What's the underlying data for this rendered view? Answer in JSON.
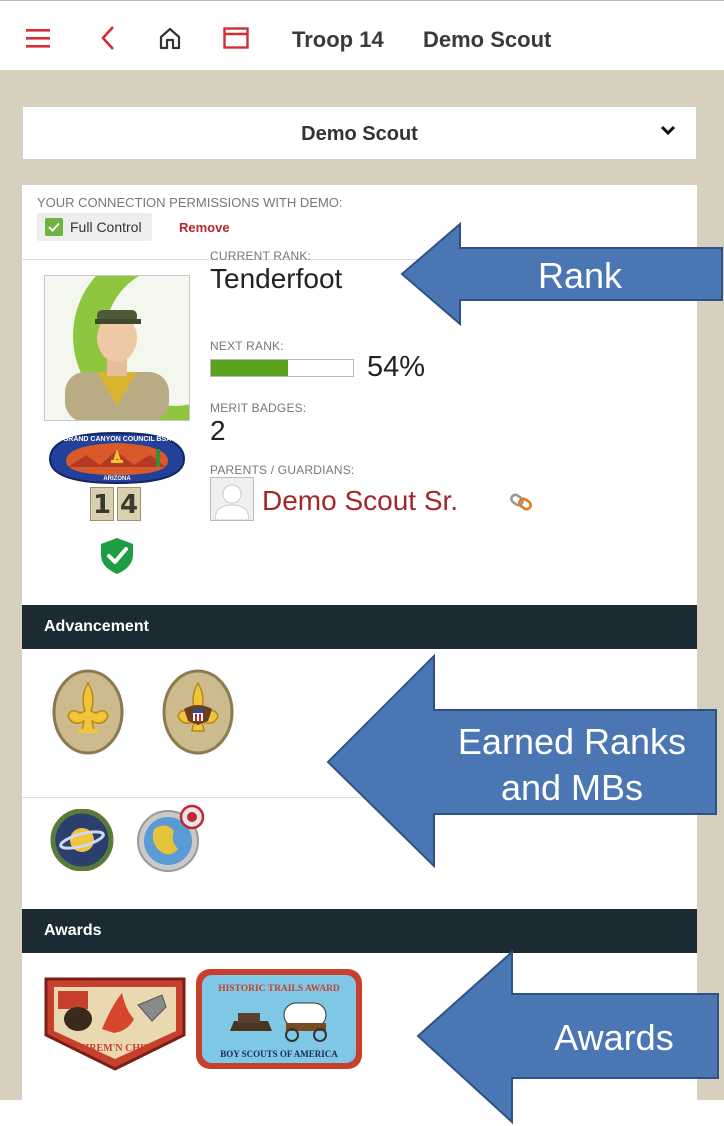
{
  "topbar": {
    "menu_icon": "hamburger-menu-icon",
    "back_icon": "chevron-left-icon",
    "home_icon": "home-icon",
    "window_icon": "browser-window-icon",
    "troop": "Troop 14",
    "scout": "Demo Scout"
  },
  "selector": {
    "value": "Demo Scout",
    "icon": "chevron-down-icon"
  },
  "permissions": {
    "title": "YOUR CONNECTION PERMISSIONS WITH DEMO:",
    "level": "Full Control",
    "remove": "Remove"
  },
  "profile": {
    "current_rank_label": "CURRENT RANK:",
    "current_rank": "Tenderfoot",
    "next_rank_label": "NEXT RANK:",
    "next_rank_progress": 0.54,
    "next_rank_percent": "54%",
    "merit_badges_label": "MERIT BADGES:",
    "merit_badges": "2",
    "parents_label": "PARENTS / GUARDIANS:",
    "parent_name": "Demo Scout Sr.",
    "council_patch_top": "GRAND CANYON COUNCIL BSA",
    "council_patch_bottom": "ARIZONA",
    "troop_digits": [
      "1",
      "4"
    ]
  },
  "sections": {
    "advancement": "Advancement",
    "awards": "Awards"
  },
  "patches": {
    "firemn_chit": "FIREM'N CHIT",
    "historic_title": "HISTORIC TRAILS AWARD",
    "historic_bottom": "BOY SCOUTS OF AMERICA"
  },
  "callouts": {
    "rank": "Rank",
    "earned_line1": "Earned Ranks",
    "earned_line2": "and MBs",
    "awards": "Awards"
  },
  "colors": {
    "accent_red": "#d42c34",
    "section_bar": "#1c2b33",
    "progress_green": "#57a31d",
    "arrow_blue": "#4a77b4",
    "frame": "#d8d0bf"
  }
}
